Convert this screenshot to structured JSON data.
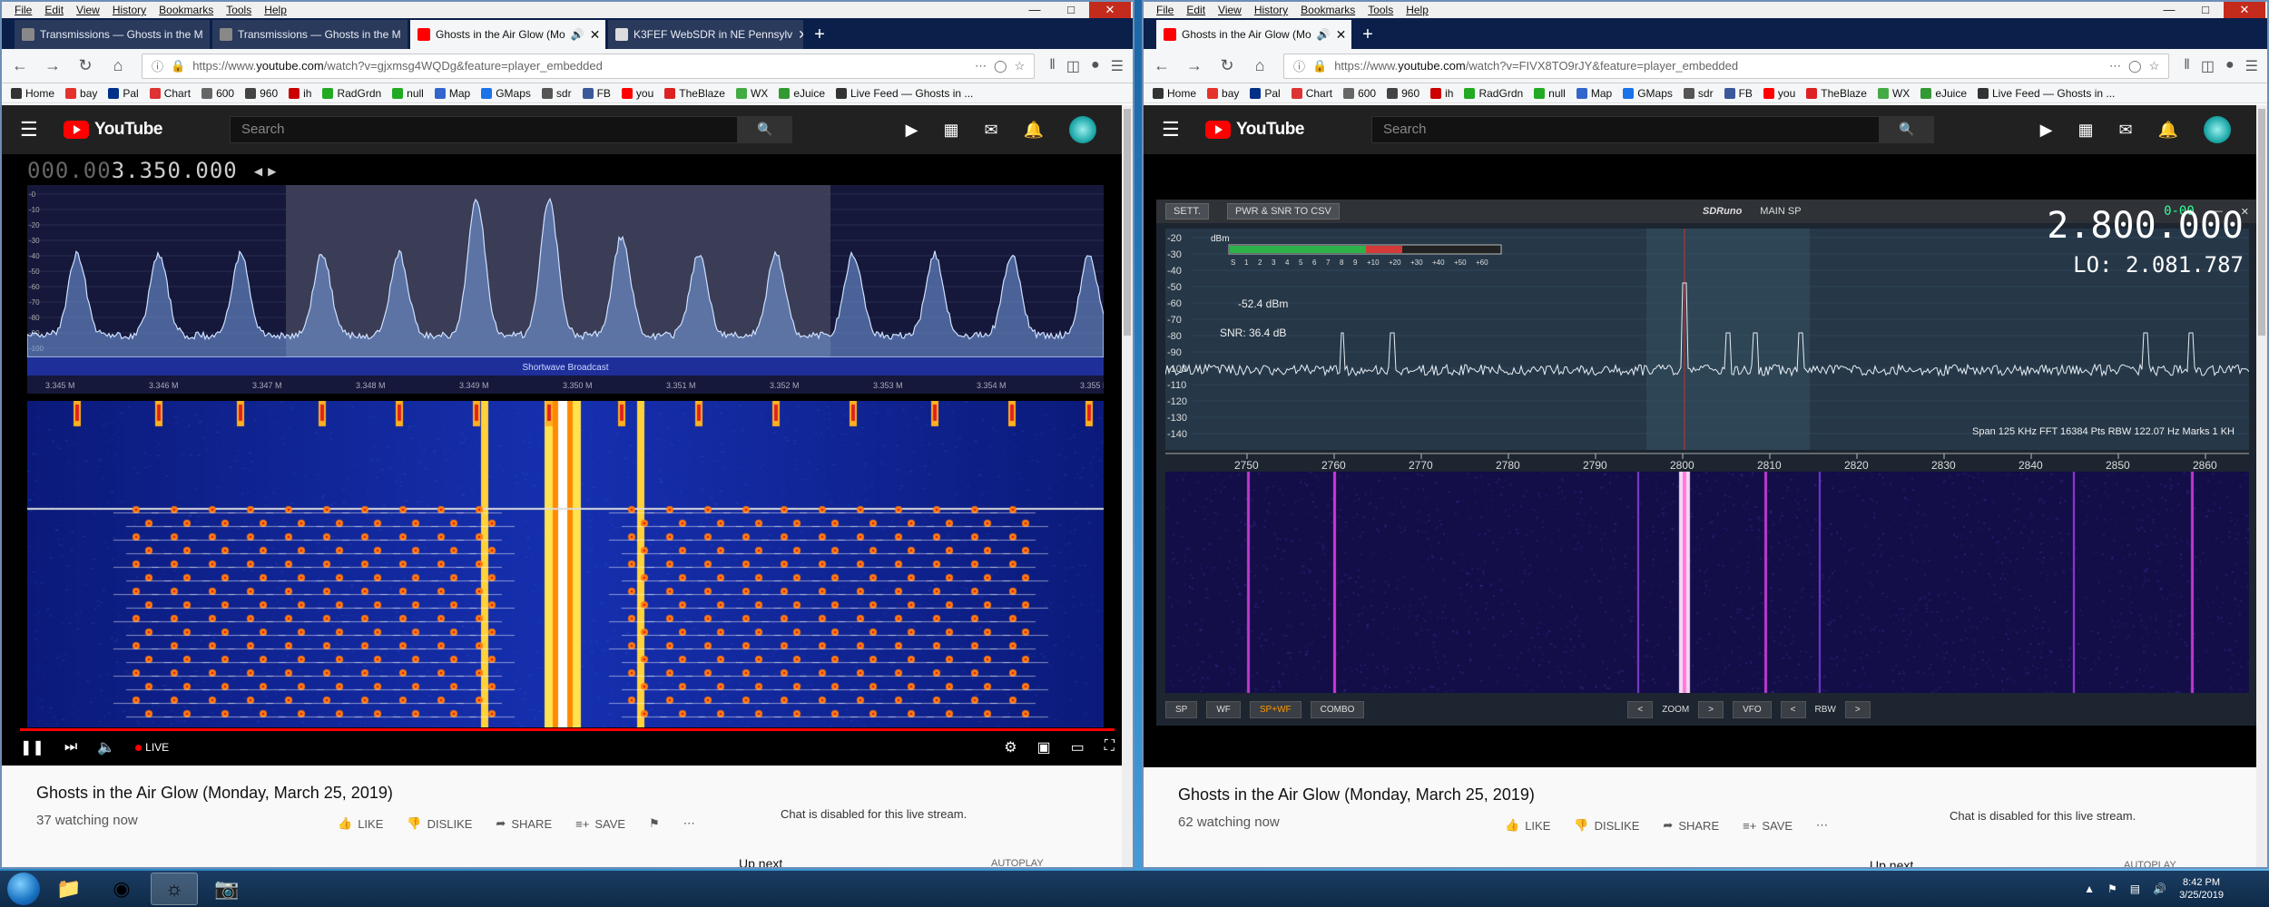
{
  "left": {
    "menu": [
      "File",
      "Edit",
      "View",
      "History",
      "Bookmarks",
      "Tools",
      "Help"
    ],
    "tabs": [
      {
        "label": "Transmissions — Ghosts in the M",
        "active": false,
        "fav": "#888"
      },
      {
        "label": "Transmissions — Ghosts in the M",
        "active": false,
        "fav": "#888"
      },
      {
        "label": "Ghosts in the Air Glow (Mo",
        "active": true,
        "fav": "#f00"
      },
      {
        "label": "K3FEF WebSDR in NE Pennsylv",
        "active": false,
        "fav": "#aaa"
      }
    ],
    "url_prefix": "https://www.",
    "url_domain": "youtube.com",
    "url_path": "/watch?v=gjxmsg4WQDg&feature=player_embedded",
    "video": {
      "title": "Ghosts in the Air Glow (Monday, March 25, 2019)",
      "watching": "37 watching now",
      "freq_dim": "000.00",
      "freq": "3.350.000",
      "band_label": "Shortwave Broadcast",
      "spec_ticks": [
        "3.345 M",
        "3.346 M",
        "3.347 M",
        "3.348 M",
        "3.349 M",
        "3.350 M",
        "3.351 M",
        "3.352 M",
        "3.353 M",
        "3.354 M",
        "3.355 M"
      ],
      "y_ticks": [
        "-0",
        "-10",
        "-20",
        "-30",
        "-40",
        "-50",
        "-60",
        "-70",
        "-80",
        "-90",
        "-100"
      ]
    },
    "chat_disabled": "Chat is disabled for this live stream.",
    "up_next": "Up next",
    "autoplay": "AUTOPLAY"
  },
  "right": {
    "menu": [
      "File",
      "Edit",
      "View",
      "History",
      "Bookmarks",
      "Tools",
      "Help"
    ],
    "tabs": [
      {
        "label": "Ghosts in the Air Glow (Mo",
        "active": true,
        "fav": "#f00"
      }
    ],
    "url_prefix": "https://www.",
    "url_domain": "youtube.com",
    "url_path": "/watch?v=FIVX8TO9rJY&feature=player_embedded",
    "video": {
      "title": "Ghosts in the Air Glow (Monday, March 25, 2019)",
      "watching": "62 watching now",
      "sett": "SETT.",
      "pwr": "PWR & SNR TO CSV",
      "sdruno": "SDRuno",
      "mainsp": "MAIN SP",
      "time": "0-00",
      "freq": "2.800.000",
      "lo_label": "LO:",
      "lo": "2.081.787",
      "dbm": "-52.4 dBm",
      "snr": "SNR: 36.4 dB",
      "dbm_unit": "dBm",
      "meter_labels": [
        "S",
        "1",
        "2",
        "3",
        "4",
        "5",
        "6",
        "7",
        "8",
        "9",
        "+10",
        "+20",
        "+30",
        "+40",
        "+50",
        "+60"
      ],
      "y_ticks": [
        "-20",
        "-30",
        "-40",
        "-50",
        "-60",
        "-70",
        "-80",
        "-90",
        "-100",
        "-110",
        "-120",
        "-130",
        "-140"
      ],
      "span": "Span 125 KHz  FFT 16384 Pts  RBW 122.07 Hz  Marks 1 KH",
      "x_ticks": [
        "2750",
        "2760",
        "2770",
        "2780",
        "2790",
        "2800",
        "2810",
        "2820",
        "2830",
        "2840",
        "2850",
        "2860"
      ],
      "bottom": [
        "SP",
        "WF",
        "SP+WF",
        "COMBO",
        "<",
        "ZOOM",
        ">",
        "VFO",
        "<",
        "RBW",
        ">"
      ]
    },
    "chat_disabled": "Chat is disabled for this live stream.",
    "up_next": "Up next",
    "autoplay": "AUTOPLAY"
  },
  "bookmarks": [
    {
      "label": "Home",
      "c": "#333"
    },
    {
      "label": "bay",
      "c": "#e5322d"
    },
    {
      "label": "Pal",
      "c": "#003087"
    },
    {
      "label": "Chart",
      "c": "#d33"
    },
    {
      "label": "600",
      "c": "#666"
    },
    {
      "label": "960",
      "c": "#444"
    },
    {
      "label": "ih",
      "c": "#c00"
    },
    {
      "label": "RadGrdn",
      "c": "#2a2"
    },
    {
      "label": "null",
      "c": "#2a2"
    },
    {
      "label": "Map",
      "c": "#36c"
    },
    {
      "label": "GMaps",
      "c": "#1a73e8"
    },
    {
      "label": "sdr",
      "c": "#555"
    },
    {
      "label": "FB",
      "c": "#3b5998"
    },
    {
      "label": "you",
      "c": "#f00"
    },
    {
      "label": "TheBlaze",
      "c": "#d22"
    },
    {
      "label": "WX",
      "c": "#4a4"
    },
    {
      "label": "eJuice",
      "c": "#393"
    },
    {
      "label": "Live Feed — Ghosts in ...",
      "c": "#333"
    }
  ],
  "youtube": {
    "logo": "YouTube",
    "search_placeholder": "Search"
  },
  "actions": {
    "like": "LIKE",
    "dislike": "DISLIKE",
    "share": "SHARE",
    "save": "SAVE"
  },
  "controls": {
    "live": "LIVE"
  },
  "taskbar": {
    "time": "8:42 PM",
    "date": "3/25/2019"
  }
}
